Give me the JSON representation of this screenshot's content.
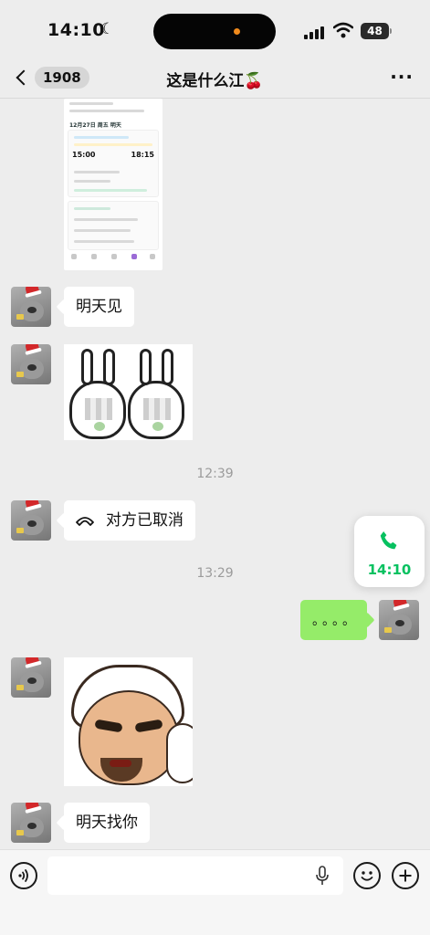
{
  "status_bar": {
    "time": "14:10",
    "battery": "48"
  },
  "nav": {
    "back_count": "1908",
    "title": "这是什么江🍒"
  },
  "screenshot": {
    "date": "12月27日 周五 明天",
    "depart_time": "15:00",
    "arrive_time": "18:15"
  },
  "messages": {
    "msg1": "明天见",
    "time1": "12:39",
    "call_cancelled": "对方已取消",
    "time2": "13:29",
    "dots": "。。。。",
    "msg_last": "明天找你"
  },
  "call_widget": {
    "time": "14:10"
  },
  "colors": {
    "accent": "#07c160",
    "bubble_green": "#95ec69",
    "background": "#ededed"
  },
  "icons": [
    "back-chevron-icon",
    "more-icon",
    "phone-hangup-icon",
    "phone-icon",
    "voice-icon",
    "microphone-icon",
    "emoji-icon",
    "plus-icon"
  ]
}
